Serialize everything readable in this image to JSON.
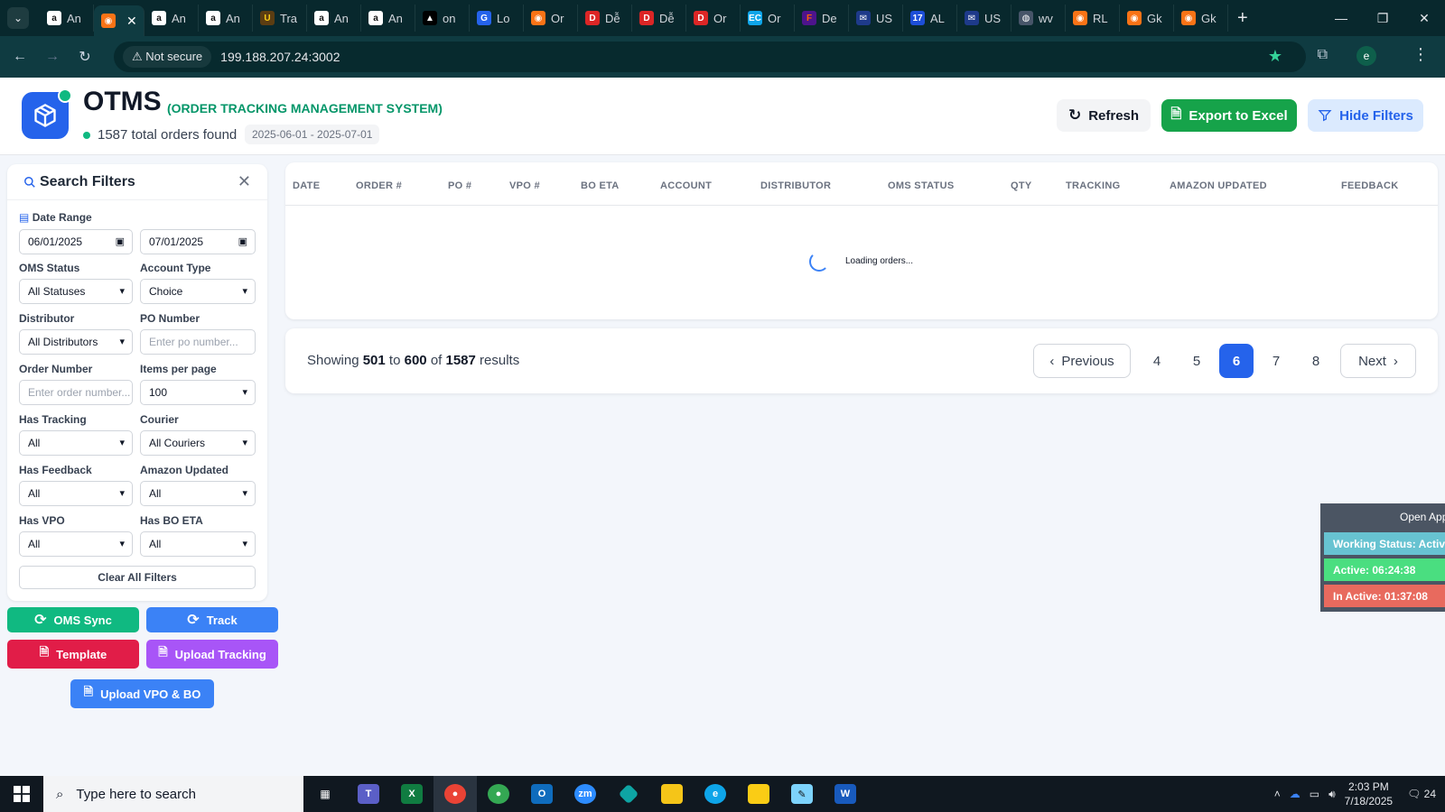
{
  "browser": {
    "tabs": [
      {
        "label": "An",
        "icon": "amazon-icon"
      },
      {
        "label": "",
        "icon": "app-icon",
        "active": true
      },
      {
        "label": "An",
        "icon": "amazon-icon"
      },
      {
        "label": "An",
        "icon": "amazon-icon"
      },
      {
        "label": "Tra",
        "icon": "ups-icon"
      },
      {
        "label": "An",
        "icon": "amazon-icon"
      },
      {
        "label": "An",
        "icon": "amazon-icon"
      },
      {
        "label": "on",
        "icon": "triangle-icon"
      },
      {
        "label": "Lo",
        "icon": "g-icon"
      },
      {
        "label": "Or",
        "icon": "app-icon"
      },
      {
        "label": "Dễ",
        "icon": "dell-icon"
      },
      {
        "label": "Dễ",
        "icon": "dell-icon"
      },
      {
        "label": "Or",
        "icon": "dell-icon"
      },
      {
        "label": "Or",
        "icon": "ec-icon"
      },
      {
        "label": "De",
        "icon": "fedex-icon"
      },
      {
        "label": "US",
        "icon": "usps-icon"
      },
      {
        "label": "AL",
        "icon": "17track-icon"
      },
      {
        "label": "US",
        "icon": "usps-icon"
      },
      {
        "label": "wv",
        "icon": "globe-icon"
      },
      {
        "label": "RL",
        "icon": "app-icon"
      },
      {
        "label": "Gk",
        "icon": "app-icon"
      },
      {
        "label": "Gk",
        "icon": "app-icon"
      }
    ],
    "not_secure": "Not secure",
    "url": "199.188.207.24:3002",
    "profile_initial": "e"
  },
  "header": {
    "title": "OTMS",
    "subtitle": "(ORDER TRACKING MANAGEMENT SYSTEM)",
    "total_orders": "1587 total orders found",
    "date_range": "2025-06-01 - 2025-07-01",
    "refresh_label": "Refresh",
    "export_label": "Export to Excel",
    "hide_filters_label": "Hide Filters"
  },
  "filters": {
    "title": "Search Filters",
    "date_range_label": "Date Range",
    "date_from": "06/01/2025",
    "date_to": "07/01/2025",
    "oms_status_label": "OMS Status",
    "oms_status_value": "All Statuses",
    "account_type_label": "Account Type",
    "account_type_value": "Choice",
    "distributor_label": "Distributor",
    "distributor_value": "All Distributors",
    "po_number_label": "PO Number",
    "po_number_placeholder": "Enter po number...",
    "order_number_label": "Order Number",
    "order_number_placeholder": "Enter order number...",
    "items_per_page_label": "Items per page",
    "items_per_page_value": "100",
    "has_tracking_label": "Has Tracking",
    "has_tracking_value": "All",
    "courier_label": "Courier",
    "courier_value": "All Couriers",
    "has_feedback_label": "Has Feedback",
    "has_feedback_value": "All",
    "amazon_updated_label": "Amazon Updated",
    "amazon_updated_value": "All",
    "has_vpo_label": "Has VPO",
    "has_vpo_value": "All",
    "has_bo_eta_label": "Has BO ETA",
    "has_bo_eta_value": "All",
    "clear_label": "Clear All Filters"
  },
  "actions": {
    "oms_sync": "OMS Sync",
    "track": "Track",
    "template": "Template",
    "upload_tracking": "Upload Tracking",
    "upload_vpo_bo": "Upload VPO & BO"
  },
  "table": {
    "columns": [
      "DATE",
      "ORDER #",
      "PO #",
      "VPO #",
      "BO ETA",
      "ACCOUNT",
      "DISTRIBUTOR",
      "OMS STATUS",
      "QTY",
      "TRACKING",
      "AMAZON UPDATED",
      "FEEDBACK"
    ],
    "loading_text": "Loading orders..."
  },
  "pagination": {
    "showing_prefix": "Showing",
    "from": "501",
    "to_word": "to",
    "to": "600",
    "of_word": "of",
    "total": "1587",
    "results_word": "results",
    "previous": "Previous",
    "next": "Next",
    "pages": [
      "4",
      "5",
      "6",
      "7",
      "8"
    ],
    "current_page": "6"
  },
  "widget": {
    "open_app": "Open App",
    "working_status": "Working Status: Active",
    "active_time": "Active: 06:24:38",
    "inactive_time": "In Active: 01:37:08"
  },
  "taskbar": {
    "search_placeholder": "Type here to search",
    "time": "2:03 PM",
    "date": "7/18/2025",
    "notifications": "24"
  },
  "colors": {
    "primary": "#2563eb",
    "success": "#16a34a",
    "teal": "#10b981",
    "rose": "#e11d48",
    "purple": "#a855f7"
  }
}
